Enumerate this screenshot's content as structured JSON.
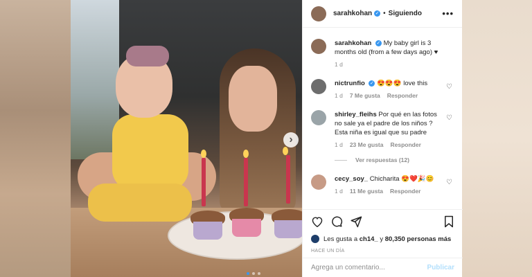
{
  "post": {
    "author": "sarahkohan",
    "separator": "•",
    "follow_label": "Siguiendo",
    "more_icon": "•••",
    "verified_glyph": "✓",
    "caption": {
      "user": "sarahkohan",
      "text": "My baby girl is 3 months old (from a few days ago) ♥",
      "time": "1 d"
    }
  },
  "comments": [
    {
      "user": "nictrunfio",
      "verified": true,
      "text": "😍😍😍 love this",
      "time": "1 d",
      "likes": "7 Me gusta",
      "reply": "Responder",
      "avatar_color": "#6d6d6d"
    },
    {
      "user": "shirley_fleihs",
      "verified": false,
      "text": "Por qué en las fotos no sale ya el padre de los niños ? Esta niña es igual que su padre",
      "time": "1 d",
      "likes": "23 Me gusta",
      "reply": "Responder",
      "avatar_color": "#9aa4a8"
    },
    {
      "user": "cecy_soy_",
      "verified": false,
      "text": "Chicharita 😍❤️🎉😊",
      "time": "1 d",
      "likes": "11 Me gusta",
      "reply": "Responder",
      "avatar_color": "#c79b86"
    }
  ],
  "view_replies": "Ver respuestas (12)",
  "likes": {
    "prefix": "Les gusta a",
    "user": "ch14_",
    "connector": "y",
    "count": "80,350 personas más"
  },
  "timestamp": "HACE UN DÍA",
  "comment_box": {
    "placeholder": "Agrega un comentario...",
    "post_label": "Publicar"
  },
  "carousel": {
    "slides": 3,
    "active_index": 0,
    "next_glyph": "›"
  },
  "colors": {
    "accent": "#3897f0",
    "text": "#262626",
    "muted": "#8e8e8e"
  }
}
